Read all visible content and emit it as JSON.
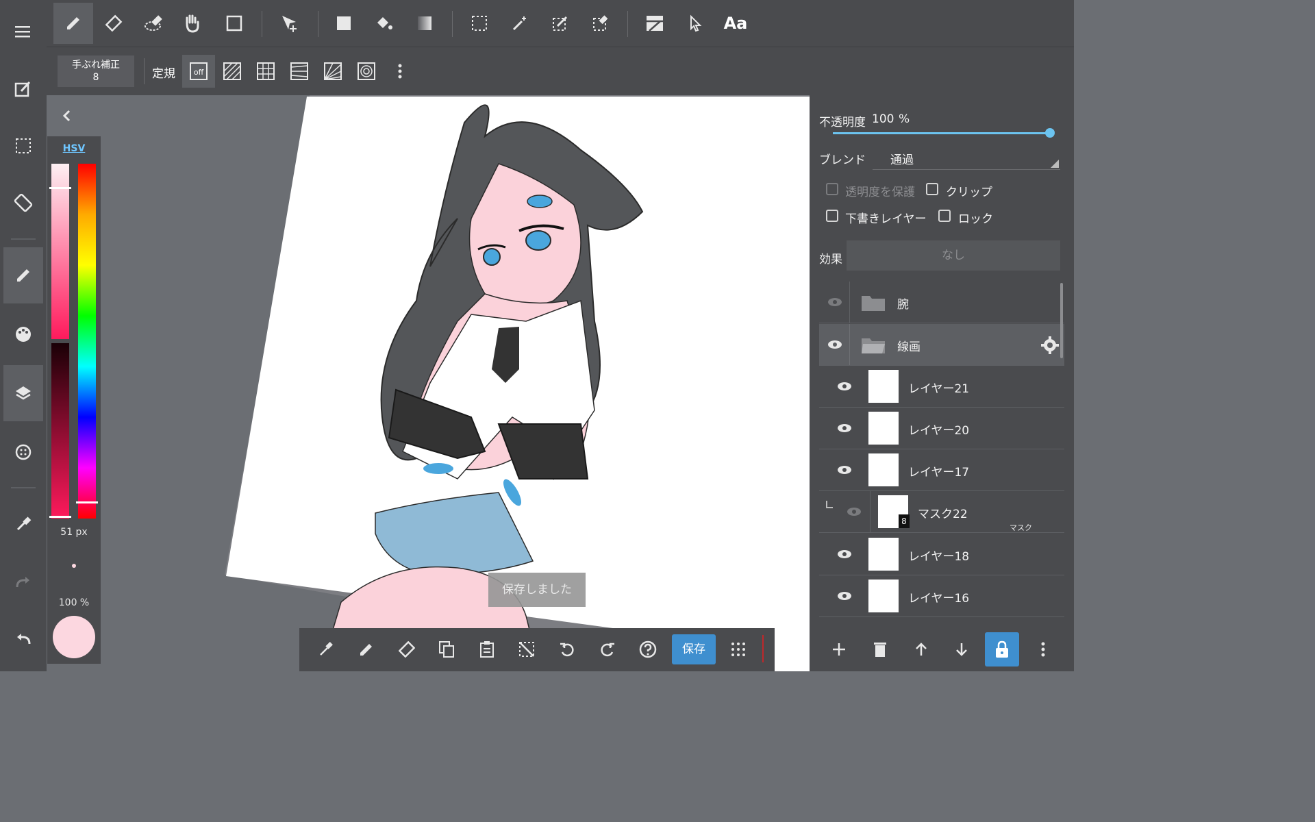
{
  "top_toolbar": {
    "tools": [
      "pen-tool",
      "eraser-tool",
      "blur-tool",
      "hand-tool",
      "shape-tool",
      "move-tool",
      "fill-tool",
      "bucket-tool",
      "gradient-tool",
      "select-rect-tool",
      "magic-wand-tool",
      "select-pen-tool",
      "select-eraser-tool",
      "layout-tool",
      "pointer-tool"
    ],
    "text_tool_label": "Aa"
  },
  "ruler_bar": {
    "stabilizer_label": "手ぶれ補正",
    "stabilizer_value": "8",
    "ruler_label": "定規",
    "off_label": "off"
  },
  "color_panel": {
    "mode": "HSV",
    "brush_size": "51 px",
    "brush_opacity": "100 %",
    "current_color": "#fcd7e0"
  },
  "layer_props": {
    "opacity_label": "不透明度",
    "opacity_value": "100",
    "opacity_unit": "%",
    "opacity_fraction": 1.0,
    "blend_label": "ブレンド",
    "blend_value": "通過",
    "protect_alpha": "透明度を保護",
    "clip": "クリップ",
    "draft_layer": "下書きレイヤー",
    "lock": "ロック",
    "effect_label": "効果",
    "effect_value": "なし"
  },
  "layers": [
    {
      "name": "腕",
      "type": "folder"
    },
    {
      "name": "線画",
      "type": "folder",
      "selected": true
    },
    {
      "name": "レイヤー21",
      "type": "layer"
    },
    {
      "name": "レイヤー20",
      "type": "layer"
    },
    {
      "name": "レイヤー17",
      "type": "layer"
    },
    {
      "name": "マスク22",
      "type": "mask",
      "badge": "8",
      "sub": "マスク"
    },
    {
      "name": "レイヤー18",
      "type": "layer"
    },
    {
      "name": "レイヤー16",
      "type": "layer"
    }
  ],
  "bottom_toolbar": {
    "save_label": "保存"
  },
  "toast": "保存しました",
  "accent_color": "#3f8fcf"
}
